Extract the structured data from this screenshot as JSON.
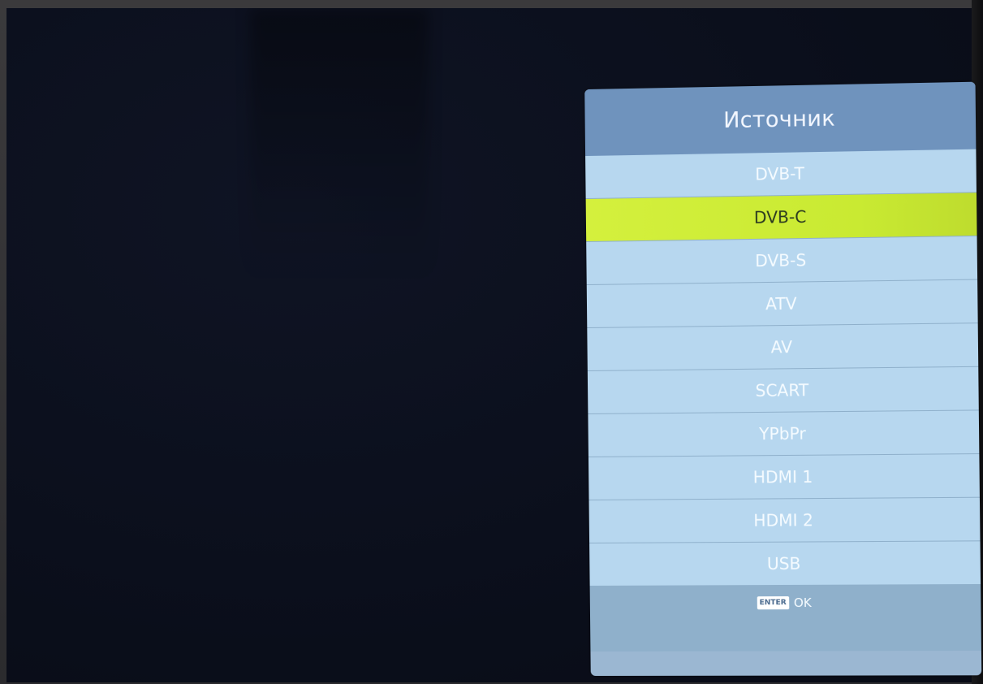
{
  "menu": {
    "title": "Источник",
    "items": [
      {
        "label": "DVB-T",
        "selected": false
      },
      {
        "label": "DVB-C",
        "selected": true
      },
      {
        "label": "DVB-S",
        "selected": false
      },
      {
        "label": "ATV",
        "selected": false
      },
      {
        "label": "AV",
        "selected": false
      },
      {
        "label": "SCART",
        "selected": false
      },
      {
        "label": "YPbPr",
        "selected": false
      },
      {
        "label": "HDMI 1",
        "selected": false
      },
      {
        "label": "HDMI 2",
        "selected": false
      },
      {
        "label": "USB",
        "selected": false
      }
    ]
  },
  "footer": {
    "enter_key_label": "ENTER",
    "ok_label": "OK"
  },
  "colors": {
    "panel_bg": "#9bb7d2",
    "title_bar": "#6f93bd",
    "item_bg": "#b7d7ef",
    "selected_highlight": "#d4f03d",
    "screen_bg": "#0b0f1c"
  }
}
